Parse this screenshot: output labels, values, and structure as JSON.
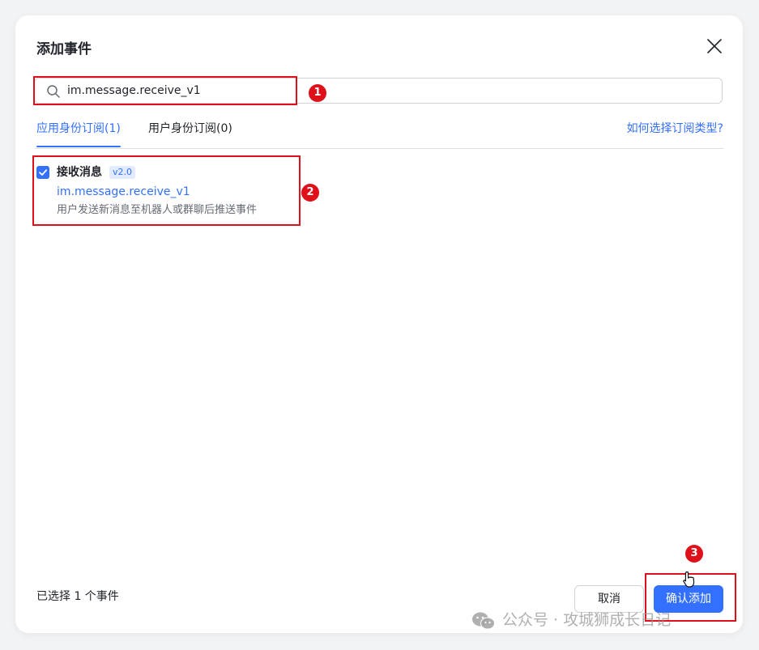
{
  "dialog": {
    "title": "添加事件",
    "close_icon": "close-icon"
  },
  "search": {
    "value": "im.message.receive_v1",
    "icon": "search-icon"
  },
  "tabs": [
    {
      "label": "应用身份订阅(1)",
      "active": true
    },
    {
      "label": "用户身份订阅(0)",
      "active": false
    }
  ],
  "help_link": "如何选择订阅类型?",
  "events": [
    {
      "name": "接收消息",
      "version": "v2.0",
      "key": "im.message.receive_v1",
      "description": "用户发送新消息至机器人或群聊后推送事件",
      "checked": true
    }
  ],
  "footer": {
    "selected_count_text": "已选择 1 个事件",
    "cancel_label": "取消",
    "confirm_label": "确认添加"
  },
  "annotations": {
    "step1": "1",
    "step2": "2",
    "step3": "3",
    "color": "#e0101a"
  },
  "watermark": {
    "text": "公众号 · 攻城狮成长日记",
    "icon": "wechat-icon"
  },
  "colors": {
    "accent": "#3370ff",
    "annotation_red": "#e0101a"
  }
}
